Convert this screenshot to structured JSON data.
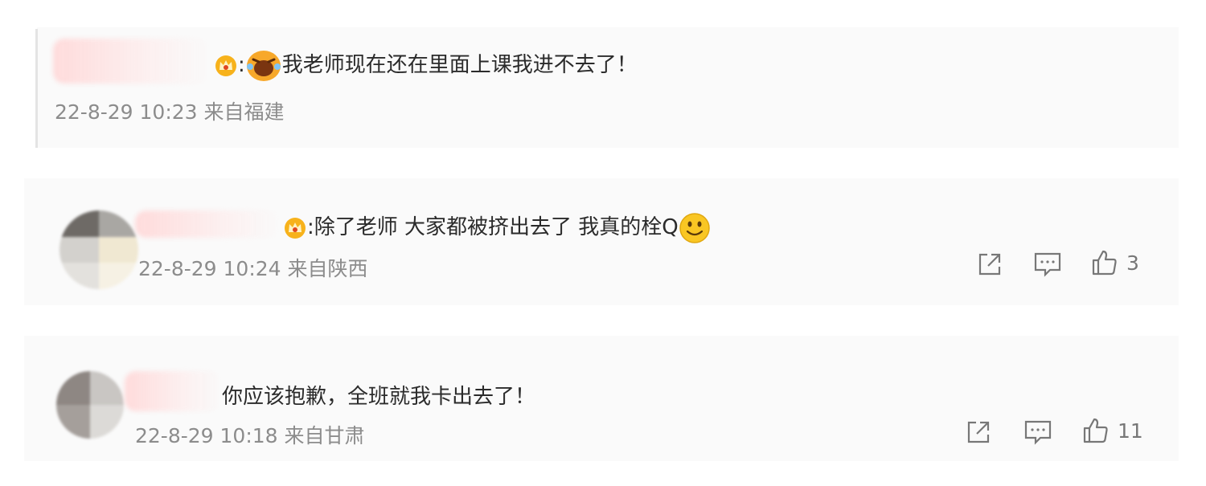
{
  "comments": [
    {
      "text": "我老师现在还在里面上课我进不去了！",
      "time": "22-8-29 10:23",
      "location": "来自福建"
    },
    {
      "text": "除了老师 大家都被挤出去了 我真的栓Q",
      "time": "22-8-29 10:24",
      "location": "来自陕西",
      "likes": "3"
    },
    {
      "text": "你应该抱歉，全班就我卡出去了！",
      "time": "22-8-29 10:18",
      "location": "来自甘肃",
      "likes": "11"
    }
  ],
  "separator": ":",
  "icons": {
    "badge": "crown-badge-icon",
    "emoji_1": "laughing-emoji-icon",
    "emoji_2": "smiley-emoji-icon",
    "share": "share-icon",
    "reply": "comment-icon",
    "like": "thumbs-up-icon"
  },
  "colors": {
    "text": "#2b2b2b",
    "meta": "#8c8c8c",
    "icon": "#777777",
    "badge": "#f2a20c"
  }
}
